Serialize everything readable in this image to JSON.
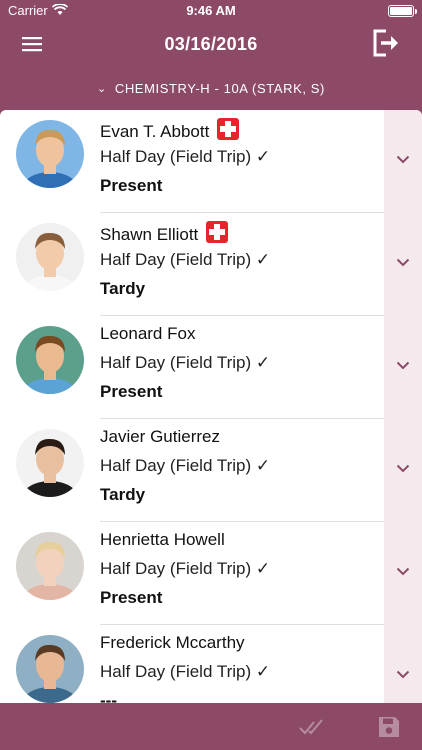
{
  "status_bar": {
    "carrier": "Carrier",
    "time": "9:46 AM",
    "battery_level": 1.0
  },
  "nav": {
    "date": "03/16/2016",
    "menu_icon": "menu-icon",
    "logout_icon": "logout-icon"
  },
  "class_selector": {
    "label": "CHEMISTRY-H - 10A  (STARK, S)",
    "icon": "chevron-down-icon"
  },
  "students": [
    {
      "name": "Evan T. Abbott",
      "health_alert": true,
      "detail": "Half Day (Field Trip) ✓",
      "status": "Present"
    },
    {
      "name": "Shawn Elliott",
      "health_alert": true,
      "detail": "Half Day (Field Trip) ✓",
      "status": "Tardy"
    },
    {
      "name": "Leonard Fox",
      "health_alert": false,
      "detail": "Half Day (Field Trip) ✓",
      "status": "Present"
    },
    {
      "name": "Javier Gutierrez",
      "health_alert": false,
      "detail": "Half Day (Field Trip) ✓",
      "status": "Tardy"
    },
    {
      "name": "Henrietta Howell",
      "health_alert": false,
      "detail": "Half Day (Field Trip) ✓",
      "status": "Present"
    },
    {
      "name": "Frederick Mccarthy",
      "health_alert": false,
      "detail": "Half Day (Field Trip) ✓",
      "status": "---"
    }
  ],
  "footer": {
    "mark_all_icon": "double-check-icon",
    "save_icon": "save-icon"
  },
  "colors": {
    "primary": "#8d4a67",
    "expand_bg": "#f4eaee",
    "health": "#e2262c"
  }
}
